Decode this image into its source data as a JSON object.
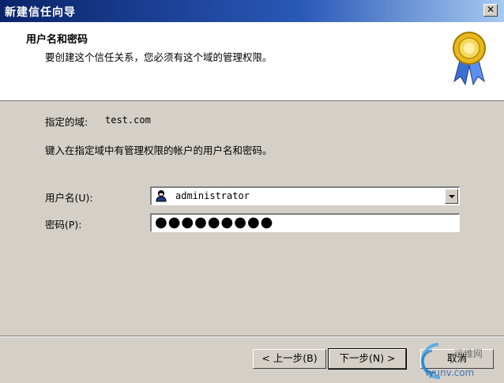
{
  "window": {
    "title": "新建信任向导",
    "close_glyph": "✕"
  },
  "header": {
    "title": "用户名和密码",
    "subtitle": "要创建这个信任关系，您必须有这个域的管理权限。",
    "icon": "award-medal-icon"
  },
  "content": {
    "domain_label": "指定的域:",
    "domain_value": "test.com",
    "instruction": "键入在指定域中有管理权限的帐户的用户名和密码。",
    "username_label": "用户名(U):",
    "username_value": "administrator",
    "username_icon": "user-icon",
    "password_label": "密码(P):",
    "password_value": "●●●●●●●●●"
  },
  "buttons": {
    "back": "< 上一步(B)",
    "next": "下一步(N) >",
    "cancel": "取消"
  },
  "watermark": {
    "line1": "运维网",
    "line2": "iyunv.com"
  },
  "colors": {
    "titlebar_start": "#0a246a",
    "titlebar_end": "#a6caf0",
    "dialog_face": "#d4d0c8"
  }
}
